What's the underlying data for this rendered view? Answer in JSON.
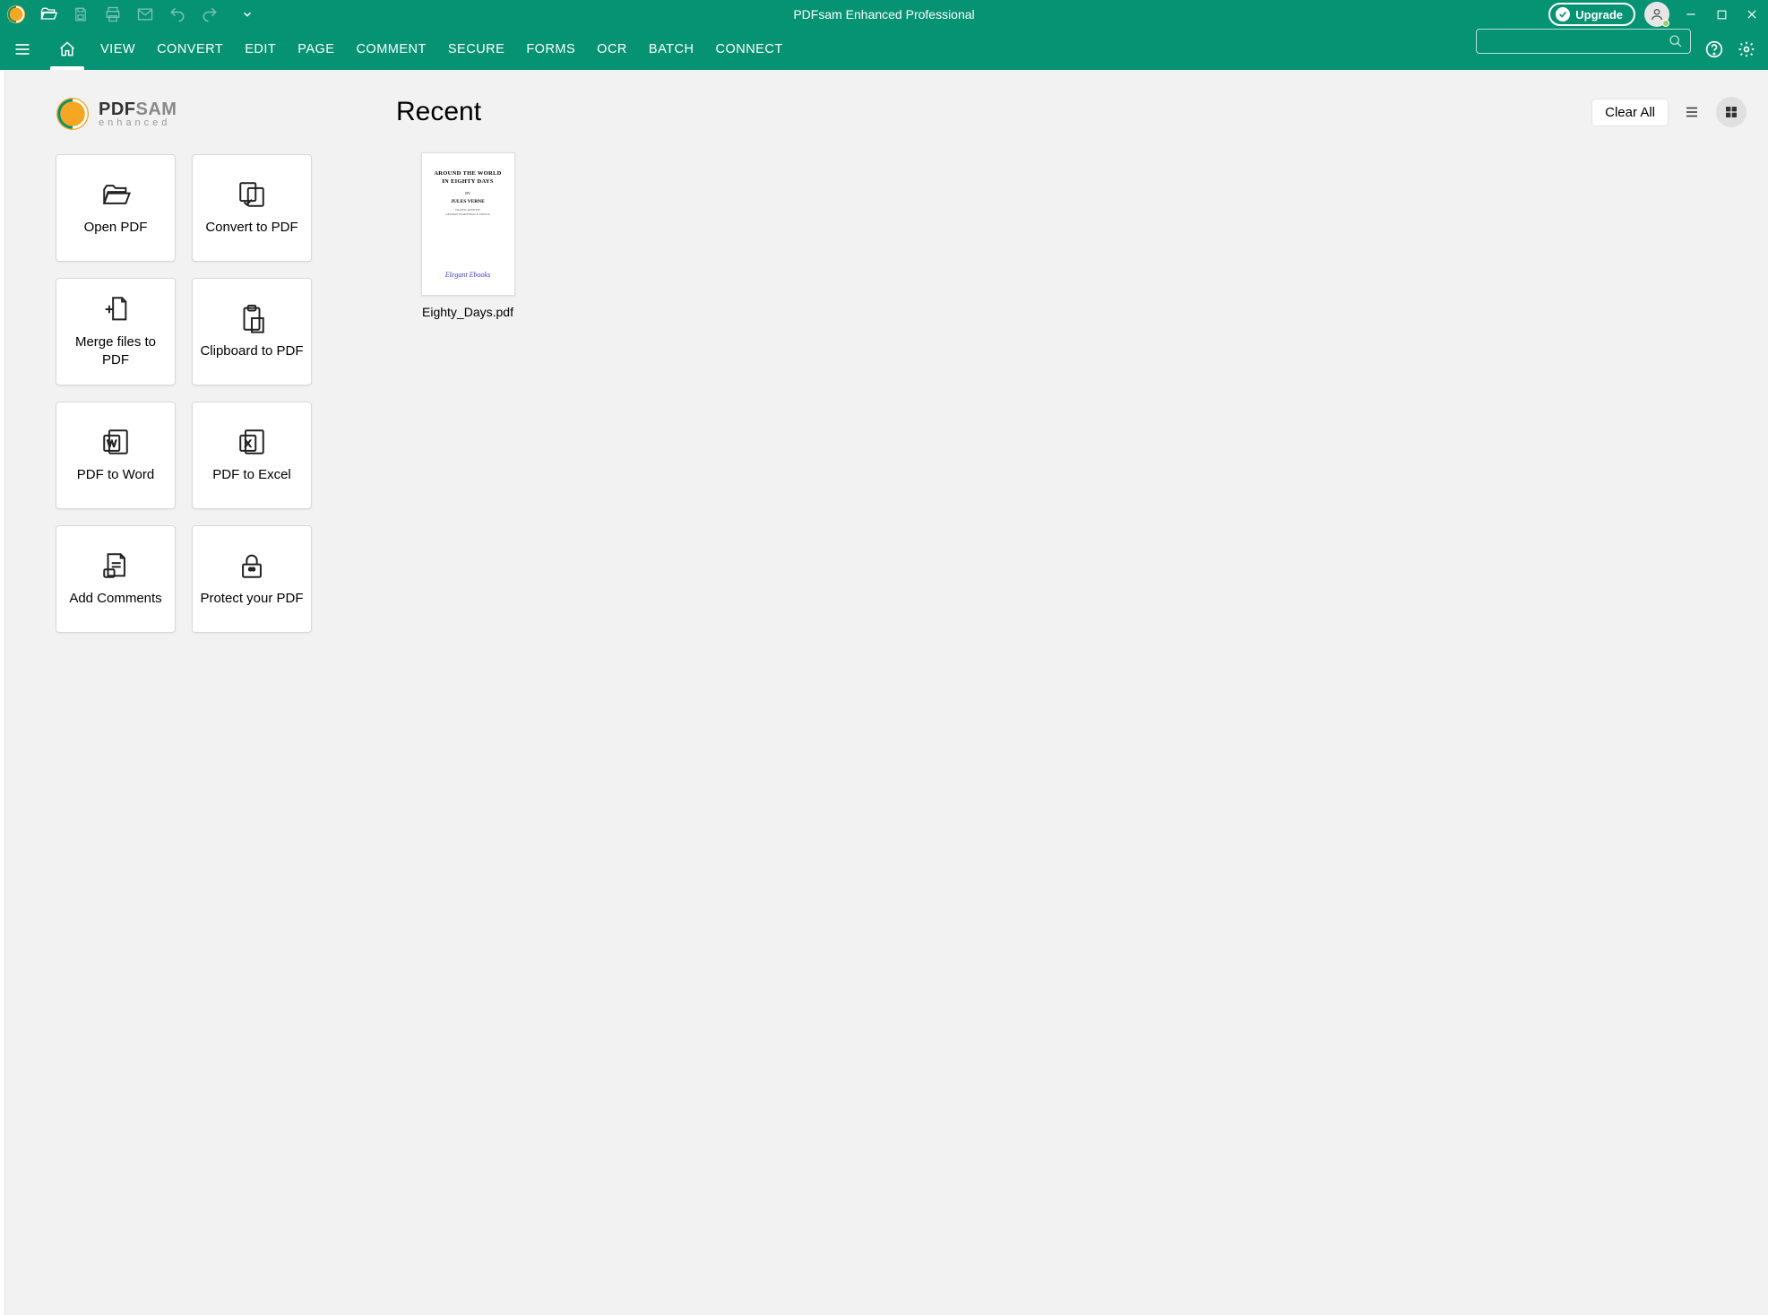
{
  "window": {
    "title": "PDFsam Enhanced Professional"
  },
  "titlebar": {
    "upgrade": "Upgrade"
  },
  "menu": {
    "items": [
      "VIEW",
      "CONVERT",
      "EDIT",
      "PAGE",
      "COMMENT",
      "SECURE",
      "FORMS",
      "OCR",
      "BATCH",
      "CONNECT"
    ]
  },
  "logo": {
    "line1a": "PDF",
    "line1b": "SAM",
    "line2": "enhanced"
  },
  "tiles": [
    {
      "label": "Open PDF"
    },
    {
      "label": "Convert to PDF"
    },
    {
      "label": "Merge files to PDF"
    },
    {
      "label": "Clipboard to PDF"
    },
    {
      "label": "PDF to Word"
    },
    {
      "label": "PDF to Excel"
    },
    {
      "label": "Add Comments"
    },
    {
      "label": "Protect your PDF"
    }
  ],
  "recent": {
    "heading": "Recent",
    "clear": "Clear All",
    "items": [
      {
        "filename": "Eighty_Days.pdf",
        "thumb": {
          "title1": "AROUND THE WORLD",
          "title2": "IN EIGHTY DAYS",
          "by": "BY",
          "author": "JULES VERNE",
          "trans1": "TRANSLATED BY",
          "trans2": "GEORGE MAKEPEACE TOWLE",
          "brand": "Elegant Ebooks"
        }
      }
    ]
  }
}
